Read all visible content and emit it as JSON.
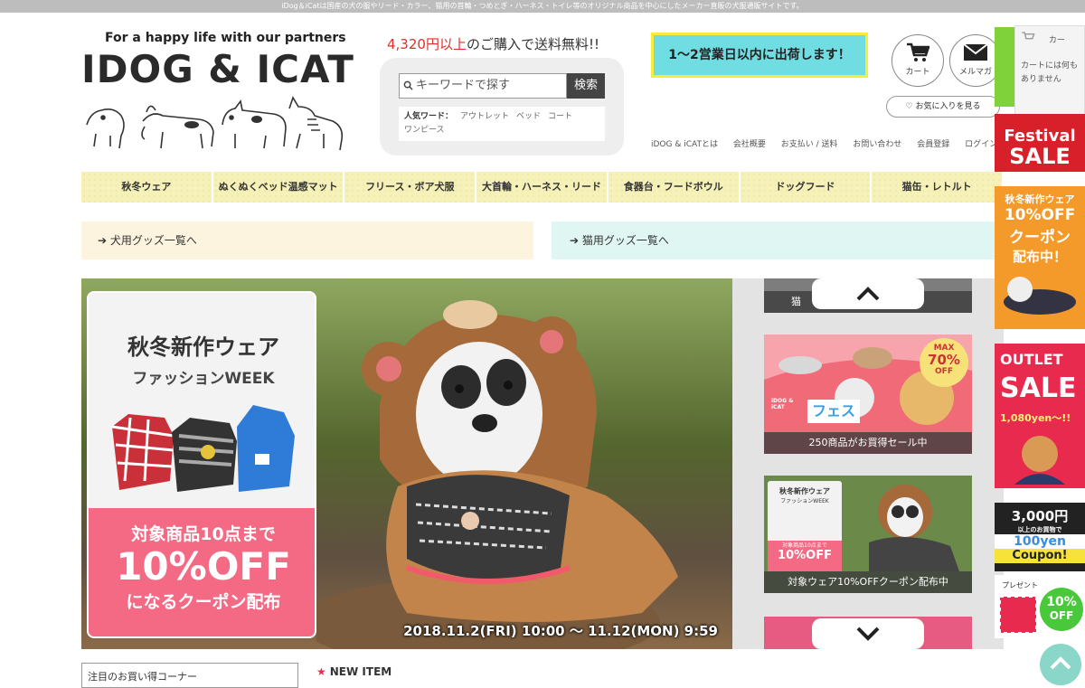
{
  "topbar": {
    "text": "iDog＆iCatは国産の犬の服やリード・カラー、猫用の首輪・つめとぎ・ハーネス・トイレ等のオリジナル商品を中心にしたメーカー直販の犬服通販サイトです。"
  },
  "logo": {
    "tagline": "For a happy life with our partners",
    "name": "IDOG & ICAT"
  },
  "promo": {
    "amount": "4,320円以上",
    "rest": "のご購入で送料無料!!"
  },
  "search": {
    "placeholder": "キーワードで探す",
    "button": "検索",
    "popular_label": "人気ワード：",
    "popular_words": [
      "アウトレット",
      "ベッド",
      "コート",
      "ワンピース"
    ]
  },
  "shipping_banner": "1〜2営業日以内に出荷します！",
  "header_buttons": {
    "cart": "カート",
    "mail": "メルマガ"
  },
  "favorites": "♡ お気に入りを見る",
  "utility_links": [
    "iDOG & iCATとは",
    "会社概要",
    "お支払い / 送料",
    "お問い合わせ",
    "会員登録",
    "ログイン"
  ],
  "categories": [
    "秋冬ウェア",
    "ぬくぬくベッド温感マット",
    "フリース・ボア犬服",
    "大首輪・ハーネス・リード",
    "食器台・フードボウル",
    "ドッグフード",
    "猫缶・レトルト"
  ],
  "dog_link": "犬用グッズ一覧へ",
  "cat_link": "猫用グッズ一覧へ",
  "hero": {
    "title1": "秋冬新作ウェア",
    "title2": "ファッションWEEK",
    "line1": "対象商品10点まで",
    "line2": "10%OFF",
    "line3": "になるクーポン配布",
    "date": "2018.11.2(FRI) 10:00 〜 11.12(MON) 9:59"
  },
  "side_thumbs": [
    {
      "caption": "猫"
    },
    {
      "caption": "250商品がお買得セール中",
      "badge_top": "MAX",
      "badge_pct": "70%",
      "badge_off": "OFF",
      "brand": "iDOG & iCAT",
      "label": "フェス"
    },
    {
      "caption": "対象ウェア10%OFFクーポン配布中",
      "t1": "秋冬新作ウェア",
      "t2": "ファッションWEEK",
      "t3": "対象商品10点まで",
      "t4": "10%OFF"
    }
  ],
  "cart_popup": {
    "title": "カー",
    "text": "カートには何もありません"
  },
  "right_banners": {
    "festival": [
      "Festival",
      "SALE"
    ],
    "coupon": [
      "秋冬新作ウェア",
      "10%OFF",
      "クーポン",
      "配布中！"
    ],
    "outlet": [
      "OUTLET",
      "SALE",
      "1,080yen〜!!"
    ],
    "coupon100": [
      "3,000円",
      "以上のお買物で",
      "100yen",
      "Coupon!"
    ],
    "gift": [
      "プレゼント",
      "10%",
      "OFF"
    ]
  },
  "colors": {
    "accent_red": "#e0302c",
    "nav_yellow": "#f6f1b8",
    "hero_pink": "#f46a84",
    "ship_bg": "#6fdde2"
  },
  "corner_title": "注目のお買い得コーナー",
  "new_item": "NEW ITEM"
}
